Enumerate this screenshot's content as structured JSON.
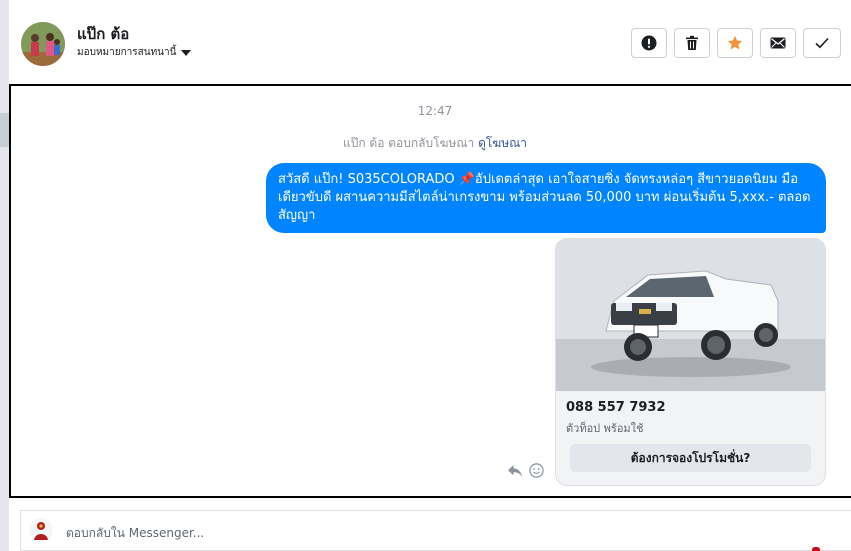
{
  "header": {
    "contact_name": "แป๊ก ต้อ",
    "assign_label": "มอบหมายการสนทนานี้"
  },
  "actions": [
    {
      "name": "spam-button",
      "icon": "exclamation-icon"
    },
    {
      "name": "delete-button",
      "icon": "trash-icon"
    },
    {
      "name": "star-button",
      "icon": "star-icon",
      "color": "#f7923a"
    },
    {
      "name": "mark-unread-button",
      "icon": "envelope-icon"
    },
    {
      "name": "done-button",
      "icon": "check-icon"
    }
  ],
  "conversation": {
    "time": "12:47",
    "reply_note_prefix": "แป๊ก ต้อ ตอบกลับโฆษณา",
    "reply_note_link": "ดูโฆษณา",
    "message_text": "สวัสดี แป๊ก! S035COLORADO 📌อัปเดตล่าสุด เอาใจสายซิ่ง จัดทรงหล่อๆ สีขาวยอดนิยม มือเดียวขับดี ผสานความมีสไตล์น่าเกรงขาม พร้อมส่วนลด 50,000 บาท ผ่อนเริ่มต้น 5,xxx.- ตลอดสัญญา",
    "card": {
      "phone": "088 557 7932",
      "subtitle": "ตัวท็อป พร้อมใช้",
      "button_label": "ต้องการจองโปรโมชั่น?"
    }
  },
  "composer": {
    "placeholder": "ตอบกลับใน Messenger..."
  },
  "colors": {
    "bubble": "#0084ff",
    "star": "#f7923a",
    "link": "#385898"
  }
}
